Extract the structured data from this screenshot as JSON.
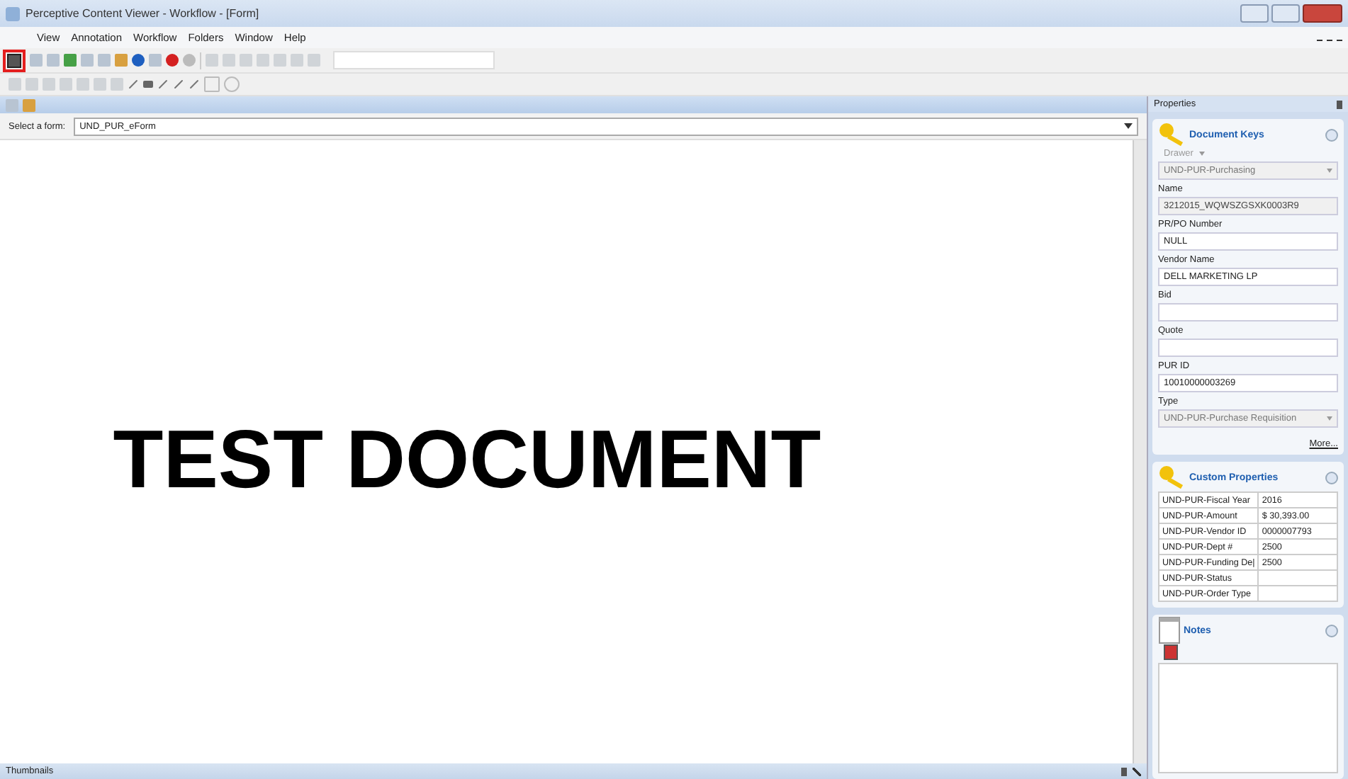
{
  "window": {
    "title": "Perceptive Content Viewer - Workflow - [Form]"
  },
  "menu": [
    {
      "label": "View"
    },
    {
      "label": "Annotation"
    },
    {
      "label": "Workflow"
    },
    {
      "label": "Folders"
    },
    {
      "label": "Window"
    },
    {
      "label": "Help"
    }
  ],
  "form_selector": {
    "label": "Select a form:",
    "value": "UND_PUR_eForm"
  },
  "document": {
    "text": "TEST DOCUMENT"
  },
  "thumbnails": {
    "title": "Thumbnails"
  },
  "properties": {
    "title": "Properties",
    "document_keys": {
      "title": "Document Keys",
      "drawer_label": "Drawer",
      "more_link": "More...",
      "fields": [
        {
          "value": "UND-PUR-Purchasing",
          "kind": "select",
          "disabled": true
        },
        {
          "label": "Name",
          "value": "3212015_WQWSZGSXK0003R9",
          "kind": "text",
          "disabled": true
        },
        {
          "label": "PR/PO Number",
          "value": "NULL",
          "kind": "text",
          "disabled": false
        },
        {
          "label": "Vendor Name",
          "value": "DELL MARKETING LP",
          "kind": "text",
          "disabled": false
        },
        {
          "label": "Bid",
          "kind": "text",
          "disabled": false
        },
        {
          "label": "Quote",
          "kind": "text",
          "disabled": false
        },
        {
          "label": "PUR ID",
          "value": "10010000003269",
          "kind": "text",
          "disabled": false
        },
        {
          "label": "Type",
          "value": "UND-PUR-Purchase Requisition",
          "kind": "select",
          "disabled": true
        }
      ]
    },
    "custom_properties": {
      "title": "Custom Properties",
      "rows": [
        {
          "name": "UND-PUR-Fiscal Year",
          "value": "2016"
        },
        {
          "name": "UND-PUR-Amount",
          "value": "$ 30,393.00"
        },
        {
          "name": "UND-PUR-Vendor ID",
          "value": "0000007793"
        },
        {
          "name": "UND-PUR-Dept #",
          "value": "2500"
        },
        {
          "name": "UND-PUR-Funding De|",
          "value": "2500"
        },
        {
          "name": "UND-PUR-Status",
          "value": ""
        },
        {
          "name": "UND-PUR-Order Type",
          "value": ""
        }
      ]
    },
    "notes": {
      "title": "Notes"
    }
  }
}
